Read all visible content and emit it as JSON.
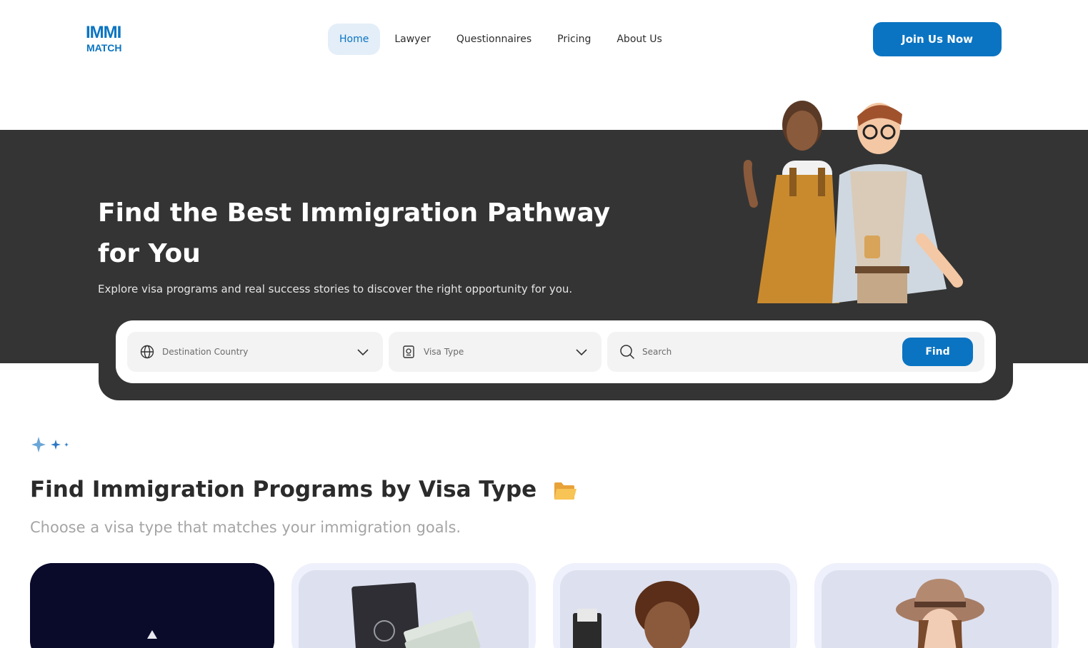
{
  "header": {
    "logo_top": "IMMI",
    "logo_bottom": "MATCH",
    "nav": [
      {
        "label": "Home",
        "active": true
      },
      {
        "label": "Lawyer"
      },
      {
        "label": "Questionnaires"
      },
      {
        "label": "Pricing"
      },
      {
        "label": "About Us"
      }
    ],
    "cta_label": "Join Us Now"
  },
  "hero": {
    "title": "Find the Best Immigration Pathway for You",
    "subtitle": "Explore visa programs and real success stories to discover the right opportunity for you."
  },
  "search": {
    "destination_placeholder": "Destination Country",
    "visa_placeholder": "Visa Type",
    "search_placeholder": "Search",
    "find_label": "Find"
  },
  "section": {
    "title": "Find Immigration Programs by Visa Type",
    "subtitle": "Choose a visa type that matches your immigration goals."
  },
  "cards": [
    {
      "icon": "dark-visa-image"
    },
    {
      "icon": "passport-money-image"
    },
    {
      "icon": "man-with-passport-image"
    },
    {
      "icon": "woman-with-hat-image"
    }
  ],
  "colors": {
    "primary": "#0a74c2",
    "hero_bg": "#343434",
    "nav_active_bg": "#e3eef8",
    "card_bg": "#dde0ef"
  }
}
